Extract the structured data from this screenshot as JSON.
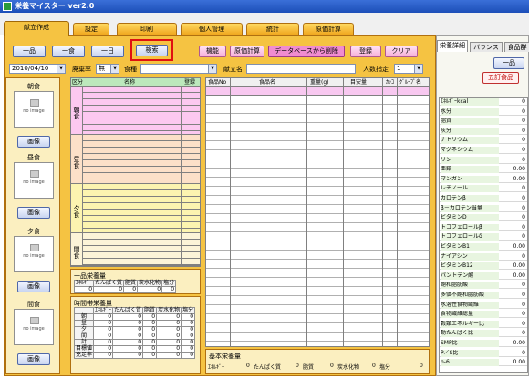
{
  "app": {
    "title": "栄養マイスター ver2.0"
  },
  "tabs": [
    "献立作成",
    "設定",
    "印刷",
    "個人管理",
    "統計",
    "原価計算"
  ],
  "toolbar": {
    "btn_one_dish": "一品",
    "btn_one_meal": "一食",
    "btn_one_day": "一日",
    "btn_search": "検索",
    "btn_function": "機能",
    "btn_cost": "原価計算",
    "btn_delete_db": "データベースから削除",
    "btn_register": "登録",
    "btn_clear": "クリア"
  },
  "filters": {
    "date": "2010/04/10",
    "disposal_label": "廃棄率",
    "disposal_value": "無",
    "food_type_label": "食種",
    "food_type_value": "",
    "menu_name_label": "献立名",
    "menu_name_value": "",
    "people_label": "人数指定",
    "people_value": "1"
  },
  "meals": {
    "breakfast": "朝食",
    "lunch": "昼食",
    "dinner": "夕食",
    "snack": "間食",
    "no_image": "no image",
    "image_btn": "画像"
  },
  "menu_grid": {
    "col_kubun": "区分",
    "col_name": "名称",
    "col_register": "登録",
    "sections": [
      "朝食",
      "昼食",
      "夕食",
      "間食"
    ]
  },
  "one_dish": {
    "title": "一品栄養量",
    "headers": [
      "ｴﾈﾙｷﾞｰ",
      "たんぱく質",
      "脂質",
      "炭水化物",
      "塩分"
    ],
    "values": [
      "0",
      "0",
      "0",
      "0",
      "0"
    ]
  },
  "time_nutrition": {
    "title": "時間帯栄養量",
    "headers": [
      "",
      "ｴﾈﾙｷﾞｰ",
      "たんぱく質",
      "脂質",
      "炭水化物",
      "塩分"
    ],
    "rows": [
      {
        "label": "朝",
        "values": [
          "0",
          "0",
          "0",
          "0",
          "0"
        ]
      },
      {
        "label": "昼",
        "values": [
          "0",
          "0",
          "0",
          "0",
          "0"
        ]
      },
      {
        "label": "夕",
        "values": [
          "0",
          "0",
          "0",
          "0",
          "0"
        ]
      },
      {
        "label": "間",
        "values": [
          "0",
          "0",
          "0",
          "0",
          "0"
        ]
      },
      {
        "label": "計",
        "values": [
          "0",
          "0",
          "0",
          "0",
          "0"
        ]
      },
      {
        "label": "目標値",
        "values": [
          "0",
          "0",
          "0",
          "0",
          "0"
        ]
      },
      {
        "label": "充足率",
        "values": [
          "0",
          "0",
          "0",
          "0",
          "0"
        ]
      }
    ]
  },
  "food_grid": {
    "headers": [
      "食品No",
      "食品名",
      "重量(g)",
      "目安量",
      "ｶｯｺ",
      "ｸﾞﾙｰﾌﾟ名"
    ]
  },
  "base_nutrition": {
    "title": "基本栄養量",
    "items": [
      {
        "label": "ｴﾈﾙｷﾞｰ",
        "value": "0"
      },
      {
        "label": "たんぱく質",
        "value": "0"
      },
      {
        "label": "脂質",
        "value": "0"
      },
      {
        "label": "炭水化物",
        "value": "0"
      },
      {
        "label": "塩分",
        "value": "0"
      }
    ]
  },
  "right_panel": {
    "tabs": [
      "栄養詳細",
      "バランス",
      "食品群"
    ],
    "btn_one_dish": "一品",
    "btn_five_foods": "五訂食品",
    "nutrients": [
      {
        "name": "ｴﾈﾙｷﾞｰkcal",
        "value": "0"
      },
      {
        "name": "水分",
        "value": "0"
      },
      {
        "name": "脂質",
        "value": "0"
      },
      {
        "name": "灰分",
        "value": "0"
      },
      {
        "name": "ナトリウム",
        "value": "0"
      },
      {
        "name": "マグネシウム",
        "value": "0"
      },
      {
        "name": "リン",
        "value": "0"
      },
      {
        "name": "亜鉛",
        "value": "0.00"
      },
      {
        "name": "マンガン",
        "value": "0.00"
      },
      {
        "name": "レチノール",
        "value": "0"
      },
      {
        "name": "カロテンβ",
        "value": "0"
      },
      {
        "name": "β－カロテン当量",
        "value": "0"
      },
      {
        "name": "ビタミンD",
        "value": "0"
      },
      {
        "name": "トコフェロールβ",
        "value": "0"
      },
      {
        "name": "トコフェロールδ",
        "value": "0"
      },
      {
        "name": "ビタミンB1",
        "value": "0.00"
      },
      {
        "name": "ナイアシン",
        "value": "0"
      },
      {
        "name": "ビタミンB12",
        "value": "0.00"
      },
      {
        "name": "パントテン酸",
        "value": "0.00"
      },
      {
        "name": "飽和脂肪酸",
        "value": "0"
      },
      {
        "name": "多価不飽和脂肪酸",
        "value": "0"
      },
      {
        "name": "水溶性食物繊維",
        "value": "0"
      },
      {
        "name": "食物繊維総量",
        "value": "0"
      },
      {
        "name": "穀類エネルギー比",
        "value": "0"
      },
      {
        "name": "動たんぱく比",
        "value": "0"
      },
      {
        "name": "SMP比",
        "value": "0.00"
      },
      {
        "name": "P／S比",
        "value": "0"
      },
      {
        "name": "n-6",
        "value": "0.00"
      }
    ]
  }
}
